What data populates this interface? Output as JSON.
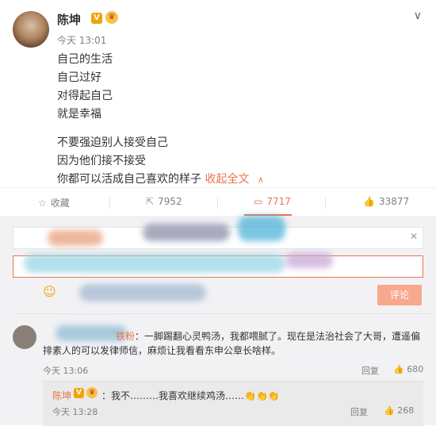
{
  "post": {
    "author": "陈坤",
    "v_badge": "V",
    "time": "今天 13:01",
    "lines": [
      "自己的生活",
      "自己过好",
      "对得起自己",
      "就是幸福",
      "不要强迫别人接受自己",
      "因为他们接不接受",
      "你都可以活成自己喜欢的样子"
    ],
    "fold_label": "收起全文"
  },
  "actions": {
    "favorite": "收藏",
    "repost": "7952",
    "comment": "7717",
    "like": "33877"
  },
  "comment_box": {
    "submit_label": "评论"
  },
  "comment": {
    "name_suffix": "铁粉",
    "text": "：一脚踢翻心灵鸭汤，我都喂腻了。现在是法治社会了大哥，遭遥偏排素人的可以发律师信，麻烦让我看看东申公章长啥样。",
    "time": "今天 13:06",
    "reply_label": "回复",
    "likes": "680"
  },
  "sub_reply": {
    "author": "陈坤",
    "v_badge": "V",
    "text": "：我不………我喜欢继续鸡汤……👏👏👏",
    "time": "今天 13:28",
    "reply_label": "回复",
    "likes": "268"
  },
  "colors": {
    "accent": "#eb7350",
    "muted": "#808080",
    "panel": "#f2f2f5"
  },
  "icons": [
    "chevron-down-icon",
    "star-icon",
    "share-icon",
    "comment-icon",
    "thumbs-up-icon",
    "close-icon",
    "smile-icon"
  ]
}
